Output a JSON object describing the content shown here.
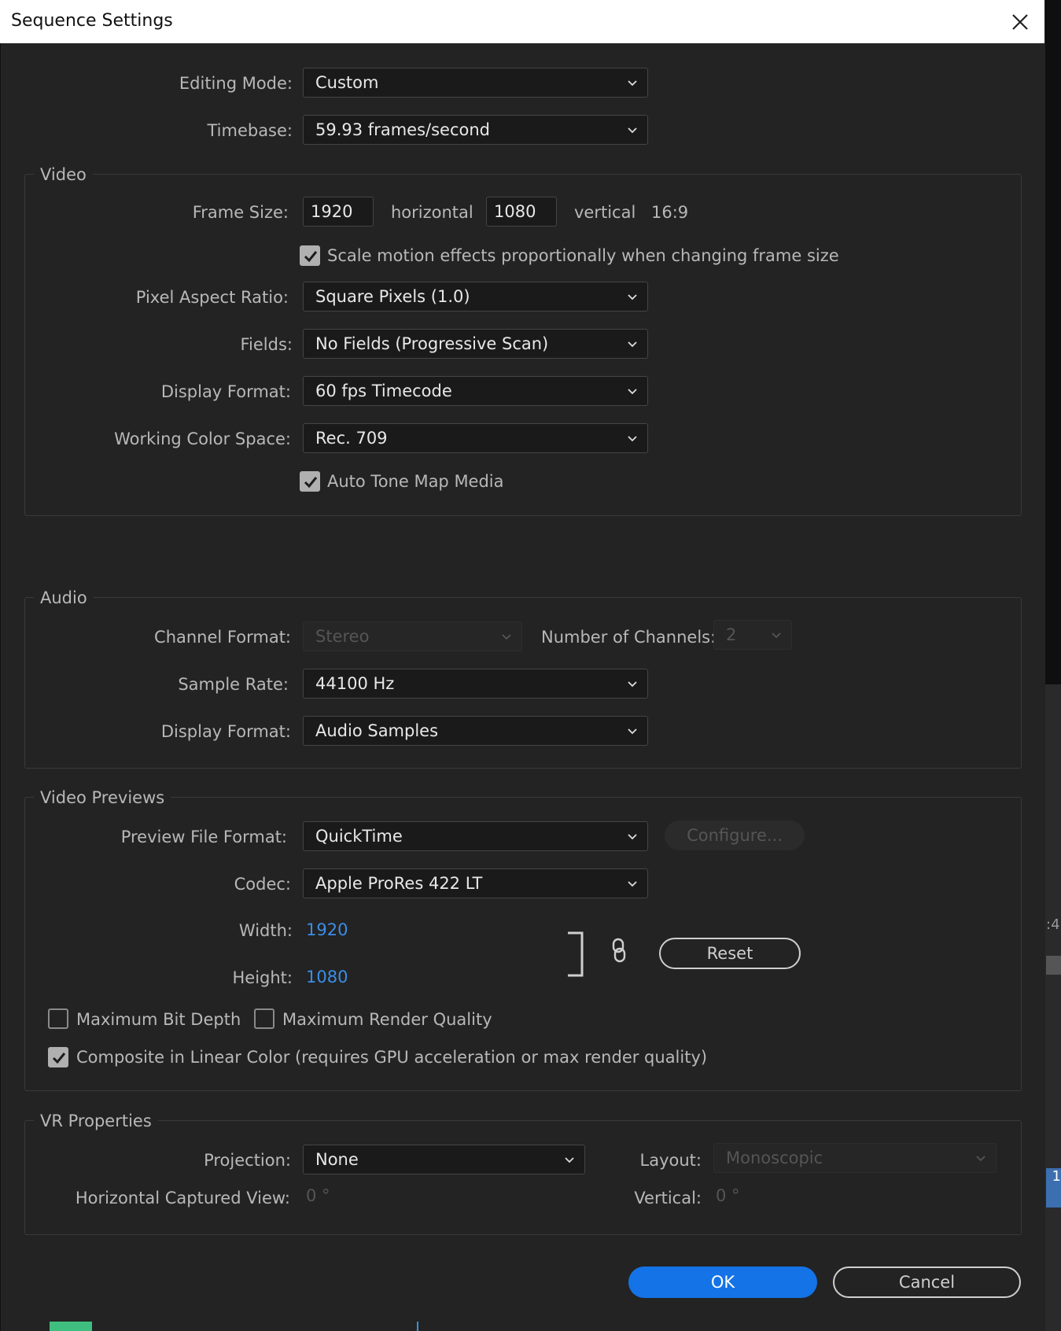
{
  "window": {
    "title": "Sequence Settings"
  },
  "general": {
    "editing_mode_label": "Editing Mode:",
    "editing_mode_value": "Custom",
    "timebase_label": "Timebase:",
    "timebase_value": "59.93  frames/second"
  },
  "video": {
    "legend": "Video",
    "frame_size_label": "Frame Size:",
    "frame_width": "1920",
    "horizontal_label": "horizontal",
    "frame_height": "1080",
    "vertical_label": "vertical",
    "aspect": "16:9",
    "scale_motion_label": "Scale motion effects proportionally when changing frame size",
    "scale_motion_checked": true,
    "par_label": "Pixel Aspect Ratio:",
    "par_value": "Square Pixels (1.0)",
    "fields_label": "Fields:",
    "fields_value": "No Fields (Progressive Scan)",
    "display_format_label": "Display Format:",
    "display_format_value": "60 fps Timecode",
    "color_space_label": "Working Color Space:",
    "color_space_value": "Rec. 709",
    "auto_tone_label": "Auto Tone Map Media",
    "auto_tone_checked": true
  },
  "audio": {
    "legend": "Audio",
    "channel_format_label": "Channel Format:",
    "channel_format_value": "Stereo",
    "num_channels_label": "Number of Channels:",
    "num_channels_value": "2",
    "sample_rate_label": "Sample Rate:",
    "sample_rate_value": "44100 Hz",
    "display_format_label": "Display Format:",
    "display_format_value": "Audio Samples"
  },
  "previews": {
    "legend": "Video Previews",
    "file_format_label": "Preview File Format:",
    "file_format_value": "QuickTime",
    "configure_label": "Configure...",
    "codec_label": "Codec:",
    "codec_value": "Apple ProRes 422 LT",
    "width_label": "Width:",
    "width_value": "1920",
    "height_label": "Height:",
    "height_value": "1080",
    "reset_label": "Reset",
    "max_bit_depth_label": "Maximum Bit Depth",
    "max_bit_depth_checked": false,
    "max_render_label": "Maximum Render Quality",
    "max_render_checked": false,
    "linear_color_label": "Composite in Linear Color (requires GPU acceleration or max render quality)",
    "linear_color_checked": true
  },
  "vr": {
    "legend": "VR Properties",
    "projection_label": "Projection:",
    "projection_value": "None",
    "layout_label": "Layout:",
    "layout_value": "Monoscopic",
    "h_view_label": "Horizontal Captured View:",
    "h_view_value": "0 °",
    "vertical_label": "Vertical:",
    "vertical_value": "0 °"
  },
  "footer": {
    "ok_label": "OK",
    "cancel_label": "Cancel"
  },
  "background": {
    "edge_text_1": ":4",
    "edge_text_2": "1"
  },
  "colors": {
    "accent": "#1473e6",
    "link_value": "#3a8ee6",
    "dialog_bg": "#232323"
  }
}
